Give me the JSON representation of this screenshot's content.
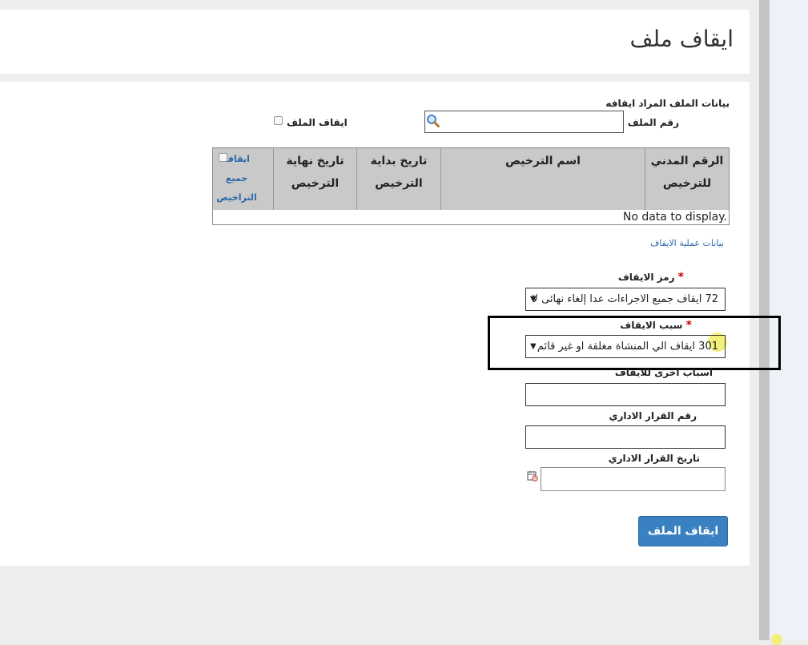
{
  "page": {
    "title": "ايقاف ملف"
  },
  "file_section": {
    "title": "بيانات الملف المراد ايقافه",
    "file_number_label": "رقم الملف",
    "file_number_value": "",
    "suspend_file_label": "ايقاف الملف",
    "search_icon": "magnifier-icon"
  },
  "licenses_grid": {
    "columns": [
      "الرقم المدني للترخيص",
      "اسم الترخيص",
      "تاريخ بداية الترخيص",
      "تاريخ نهاية الترخيص"
    ],
    "select_all_label": "ايقاف جميع التراخيص",
    "empty_text": "No data to display."
  },
  "operation_section": {
    "link": "بيانات عملية الايقاف",
    "suspension_code_label": "رمز الايقاف",
    "suspension_code_value": "72 ايقاف جميع الاجراءات عدا إلغاء نهائى لا",
    "suspension_reason_label": "سبب الايقاف",
    "suspension_reason_value": "301 ايقاف الي المنشاة مغلقة او غير قائم",
    "other_reasons_label": "اسباب اخرى للايقاف",
    "decision_number_label": "رقم القرار الاداري",
    "decision_date_label": "تاريخ القرار الاداري",
    "required_mark": "*",
    "dropdown_arrow": "▼"
  },
  "actions": {
    "submit_label": "ايقاف الملف"
  },
  "colors": {
    "accent": "#3a81c1",
    "link": "#2a67a8",
    "required": "#cc0000",
    "grid_header": "#c9c9c9"
  }
}
